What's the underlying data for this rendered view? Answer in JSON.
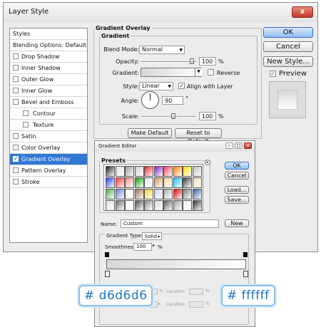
{
  "layer_style": {
    "title": "Layer Style",
    "close_glyph": "x",
    "styles_list": [
      {
        "label": "Styles",
        "type": "head"
      },
      {
        "label": "Blending Options: Default",
        "type": "head"
      },
      {
        "label": "Drop Shadow",
        "checked": false
      },
      {
        "label": "Inner Shadow",
        "checked": false
      },
      {
        "label": "Outer Glow",
        "checked": false
      },
      {
        "label": "Inner Glow",
        "checked": false
      },
      {
        "label": "Bevel and Emboss",
        "checked": false
      },
      {
        "label": "Contour",
        "checked": false,
        "type": "sub"
      },
      {
        "label": "Texture",
        "checked": false,
        "type": "sub"
      },
      {
        "label": "Satin",
        "checked": false
      },
      {
        "label": "Color Overlay",
        "checked": false
      },
      {
        "label": "Gradient Overlay",
        "checked": true,
        "selected": true
      },
      {
        "label": "Pattern Overlay",
        "checked": false
      },
      {
        "label": "Stroke",
        "checked": false
      }
    ],
    "group_title": "Gradient Overlay",
    "subgroup_title": "Gradient",
    "blend_mode_label": "Blend Mode:",
    "blend_mode_value": "Normal",
    "opacity_label": "Opacity:",
    "opacity_value": "100",
    "gradient_label": "Gradient:",
    "reverse_label": "Reverse",
    "reverse_checked": false,
    "style_label": "Style:",
    "style_value": "Linear",
    "align_label": "Align with Layer",
    "align_checked": true,
    "angle_label": "Angle:",
    "angle_value": "90",
    "degree_unit": "°",
    "percent_unit": "%",
    "scale_label": "Scale:",
    "scale_value": "100",
    "make_default_label": "Make Default",
    "reset_default_label": "Reset to Default",
    "ok_label": "OK",
    "cancel_label": "Cancel",
    "new_style_label": "New Style...",
    "preview_label": "Preview",
    "preview_checked": true
  },
  "gradient_editor": {
    "title": "Gradient Editor",
    "presets_label": "Presets",
    "ok_label": "OK",
    "cancel_label": "Cancel",
    "load_label": "Load...",
    "save_label": "Save...",
    "name_label": "Name:",
    "name_value": "Custom",
    "new_label": "New",
    "gradient_type_label": "Gradient Type:",
    "gradient_type_value": "Solid",
    "smoothness_label": "Smoothness:",
    "smoothness_value": "100",
    "percent_unit": "%",
    "stops_label": "Stops",
    "location_label": "Location:",
    "presets_colors": [
      [
        "#202020",
        "#e0e0e0",
        "#9a9a9a",
        "#cfcfcf",
        "#ff2020",
        "#7a20c0",
        "#ff4060",
        "#ff8a00",
        "#ffe000",
        "#c0c0c0"
      ],
      [
        "#3040ff",
        "#ff3030",
        "#ff9090",
        "#10a010",
        "#e8e8e8",
        "#d4a060",
        "#ffd9a0",
        "#20c0ff",
        "#404040",
        "#f0e0b0"
      ],
      [
        "#50b050",
        "#7080d0",
        "#ffffff",
        "#9a7050",
        "#ffd030",
        "#d0d0ff",
        "#b0b0b0",
        "#e00000",
        "#808080",
        "#3060a0"
      ],
      [
        "#e0e0e0",
        "#707070",
        "#ffffff",
        "#505050",
        "#909090",
        "#d8d8d8",
        "#606060",
        "#a0a0a0",
        "#f0f0f0",
        "#303030"
      ]
    ],
    "gradient_start_color": "#d6d6d6",
    "gradient_end_color": "#ffffff"
  },
  "annotations": {
    "left_color": "# d6d6d6",
    "right_color": "# ffffff"
  }
}
